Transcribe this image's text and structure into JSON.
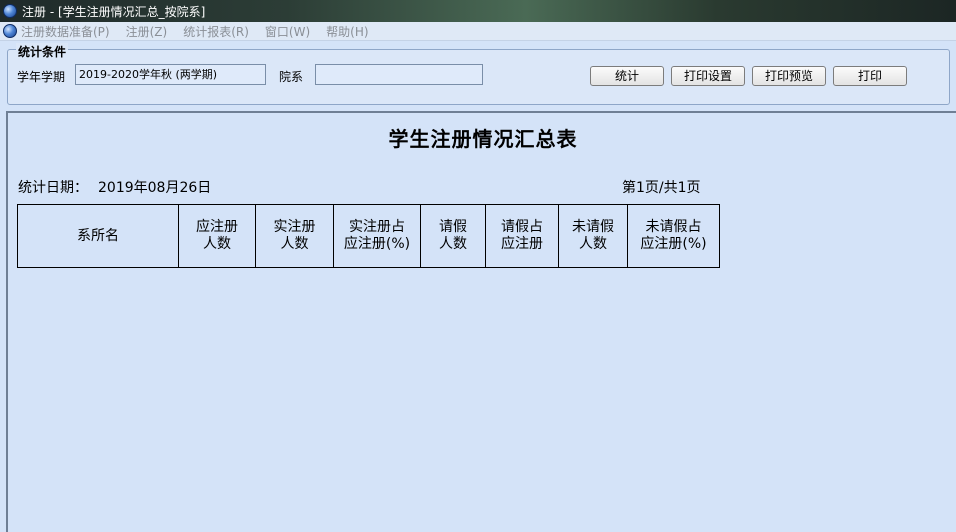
{
  "window": {
    "title": "注册 - [学生注册情况汇总_按院系]"
  },
  "menu": {
    "items": [
      "注册数据准备(P)",
      "注册(Z)",
      "统计报表(R)",
      "窗口(W)",
      "帮助(H)"
    ]
  },
  "conditions": {
    "legend": "统计条件",
    "term_label": "学年学期",
    "term_value": "2019-2020学年秋 (两学期)",
    "dept_label": "院系",
    "dept_value": "",
    "buttons": {
      "stats": "统计",
      "print_setup": "打印设置",
      "print_preview": "打印预览",
      "print": "打印"
    }
  },
  "report": {
    "title": "学生注册情况汇总表",
    "date_label": "统计日期：",
    "date_value": "2019年08月26日",
    "page_info": "第1页/共1页",
    "columns": [
      {
        "line1": "系所名",
        "line2": ""
      },
      {
        "line1": "应注册",
        "line2": "人数"
      },
      {
        "line1": "实注册",
        "line2": "人数"
      },
      {
        "line1": "实注册占",
        "line2": "应注册(%)"
      },
      {
        "line1": "请假",
        "line2": "人数"
      },
      {
        "line1": "请假占",
        "line2": "应注册"
      },
      {
        "line1": "未请假",
        "line2": "人数"
      },
      {
        "line1": "未请假占",
        "line2": "应注册(%)"
      }
    ]
  }
}
